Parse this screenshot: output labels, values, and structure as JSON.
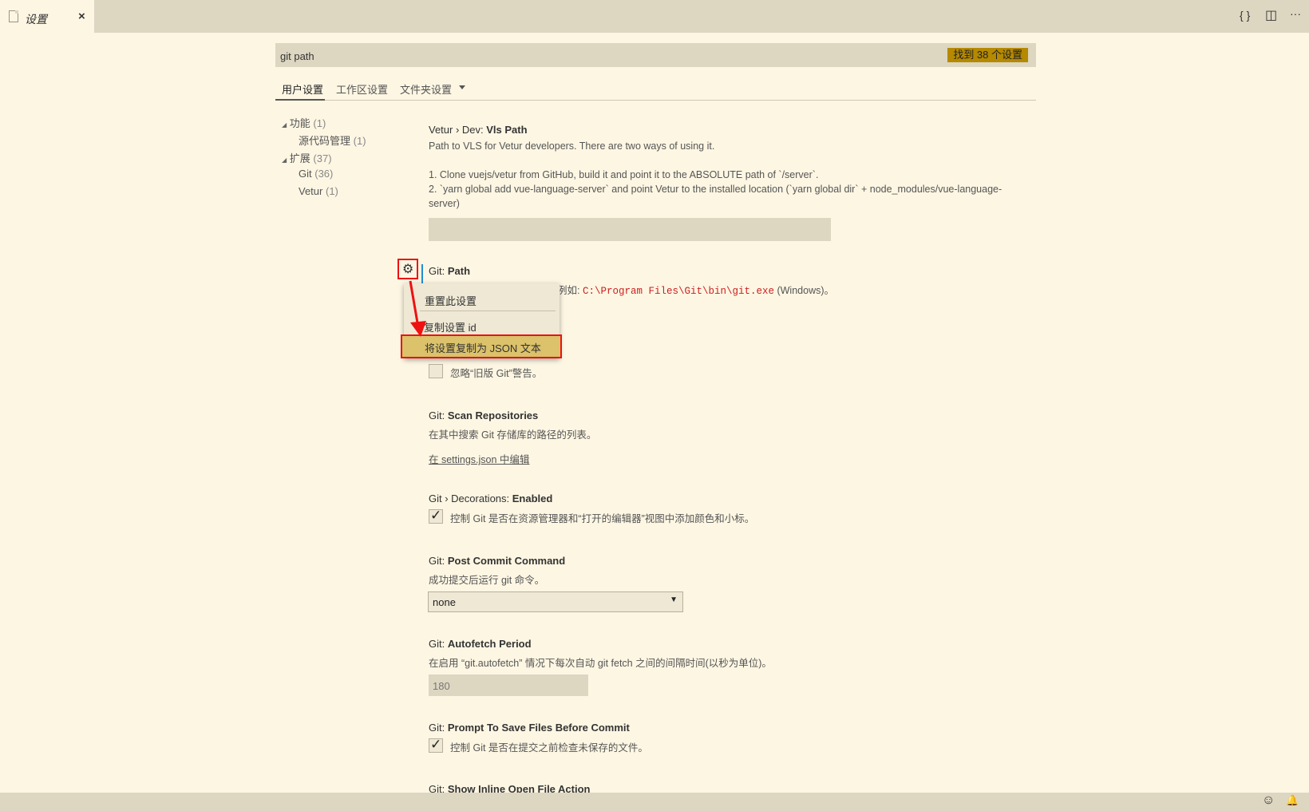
{
  "tab": {
    "title": "设置",
    "close": "×"
  },
  "toolbar": {
    "open_json": "{ }",
    "split": "◫",
    "more": "···"
  },
  "search": {
    "value": "git path",
    "placeholder": "",
    "count": "找到 38 个设置"
  },
  "scopes": {
    "user": "用户设置",
    "workspace": "工作区设置",
    "folder": "文件夹设置"
  },
  "toc": [
    {
      "label": "功能",
      "count": "(1)"
    },
    {
      "label": "源代码管理",
      "count": "(1)"
    },
    {
      "label": "扩展",
      "count": "(37)"
    },
    {
      "label": "Git",
      "count": "(36)"
    },
    {
      "label": "Vetur",
      "count": "(1)"
    }
  ],
  "vetur_vls": {
    "prefix": "Vetur › Dev: ",
    "name": "Vls Path",
    "desc1": "Path to VLS for Vetur developers. There are two ways of using it.",
    "desc2": "1. Clone vuejs/vetur from GitHub, build it and point it to the ABSOLUTE path of `/server`.",
    "desc3": "2. `yarn global add vue-language-server` and point Vetur to the installed location (`yarn global dir` + node_modules/vue-language-",
    "desc4": "server)"
  },
  "git_path": {
    "prefix": "Git: ",
    "name": "Path",
    "desc_pre": "名。例如: ",
    "code": "C:\\Program Files\\Git\\bin\\git.exe",
    "desc_post": " (Windows)。"
  },
  "context_menu": {
    "reset": "重置此设置",
    "copy_id": "复制设置 id",
    "copy_json": "将设置复制为 JSON 文本"
  },
  "ignore_legacy": {
    "label": "忽略“旧版 Git”警告。",
    "checked": false
  },
  "scan_repos": {
    "prefix": "Git: ",
    "name": "Scan Repositories",
    "desc": "在其中搜索 Git 存储库的路径的列表。",
    "link": "在 settings.json 中编辑"
  },
  "decorations": {
    "prefix": "Git › Decorations: ",
    "name": "Enabled",
    "label": "控制 Git 是否在资源管理器和“打开的编辑器”视图中添加颜色和小标。",
    "checked": true
  },
  "post_commit": {
    "prefix": "Git: ",
    "name": "Post Commit Command",
    "desc": "成功提交后运行 git 命令。",
    "value": "none"
  },
  "autofetch": {
    "prefix": "Git: ",
    "name": "Autofetch Period",
    "desc": "在启用 “git.autofetch” 情况下每次自动 git fetch 之间的间隔时间(以秒为单位)。",
    "value": "180"
  },
  "prompt_save": {
    "prefix": "Git: ",
    "name": "Prompt To Save Files Before Commit",
    "label": "控制 Git 是否在提交之前检查未保存的文件。",
    "checked": true
  },
  "inline_open": {
    "prefix": "Git: ",
    "name": "Show Inline Open File Action"
  },
  "status": {
    "feedback": "☺",
    "bell": "🔔"
  },
  "colors": {
    "accent": "#b58900",
    "highlight": "#e11111",
    "background": "#fdf6e3"
  }
}
